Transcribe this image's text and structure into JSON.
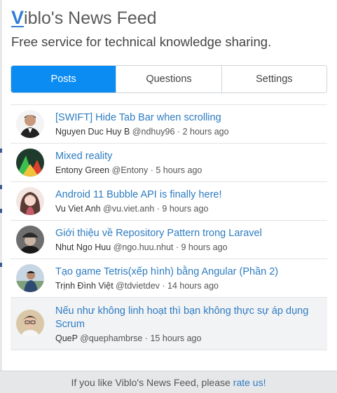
{
  "app": {
    "logo_letter": "V",
    "title_rest": "iblo's News Feed",
    "subtitle": "Free service for technical knowledge sharing."
  },
  "tabs": [
    {
      "label": "Posts",
      "active": true
    },
    {
      "label": "Questions",
      "active": false
    },
    {
      "label": "Settings",
      "active": false
    }
  ],
  "posts": [
    {
      "title": "[SWIFT] Hide Tab Bar when scrolling",
      "author": "Nguyen Duc Huy B",
      "handle": "@ndhuy96",
      "sep": " · ",
      "time": "2 hours ago",
      "avatar": "avatar-man-suit"
    },
    {
      "title": "Mixed reality",
      "author": "Entony Green",
      "handle": "@Entony",
      "sep": " · ",
      "time": "5 hours ago",
      "avatar": "avatar-green-graphic"
    },
    {
      "title": "Android 11 Bubble API is finally here!",
      "author": "Vu Viet Anh",
      "handle": "@vu.viet.anh",
      "sep": " · ",
      "time": "9 hours ago",
      "avatar": "avatar-anime-girl"
    },
    {
      "title": "Giới thiệu về Repository Pattern trong Laravel",
      "author": "Nhut Ngo Huu",
      "handle": "@ngo.huu.nhut",
      "sep": " · ",
      "time": "9 hours ago",
      "avatar": "avatar-man-cap"
    },
    {
      "title": "Tạo game Tetris(xếp hình) bằng Angular (Phần 2)",
      "author": "Trịnh Đình Việt",
      "handle": "@tdvietdev",
      "sep": " · ",
      "time": "14 hours ago",
      "avatar": "avatar-man-outdoor"
    },
    {
      "title": "Nếu như không linh hoạt thì bạn không thực sự áp dụng Scrum",
      "author": "QueP",
      "handle": "@quephambrse",
      "sep": " · ",
      "time": "15 hours ago",
      "avatar": "avatar-man-glasses"
    }
  ],
  "footer": {
    "text": "If you like Viblo's News Feed, please",
    "link": "rate us!"
  },
  "colors": {
    "accent": "#0a8cf2",
    "link": "#2d7cc1",
    "logo": "#2f7dd8"
  }
}
